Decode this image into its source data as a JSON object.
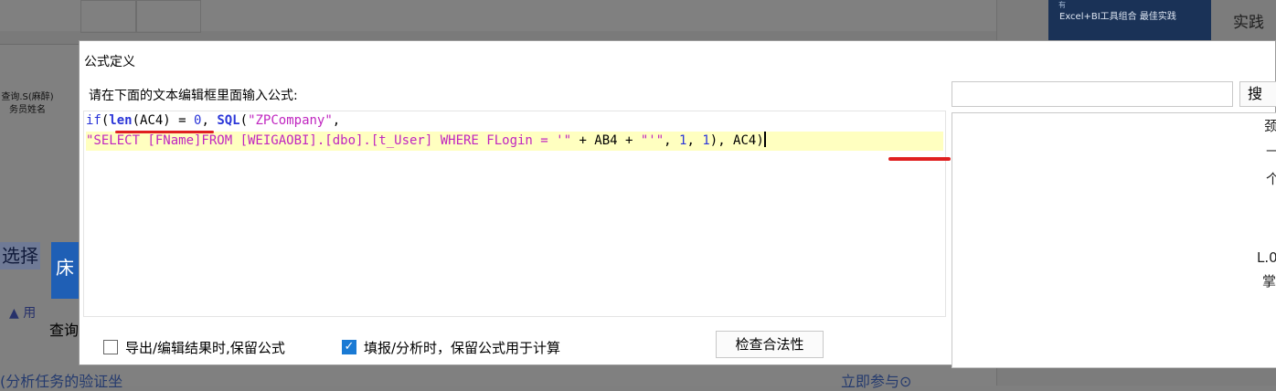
{
  "background": {
    "left_label": "查询.S(麻醉)务员姓名",
    "select_text": "选择",
    "bed_text": "床",
    "user_text": "用",
    "query_text": "查询",
    "bottom_left": "(分析任务的验证坐",
    "bottom_right": "立即参与⊙",
    "ad_small": "有",
    "ad_text": "Excel+BI工具组合 最佳实践",
    "shijian": "实践",
    "side_frags": [
      "颈",
      "—",
      "个",
      "L.0",
      "掌"
    ]
  },
  "dialog": {
    "title": "公式定义",
    "prompt": "请在下面的文本编辑框里面输入公式:",
    "search_button_label": "搜",
    "formula": {
      "line1": {
        "if": "if",
        "p1": "(",
        "len": "len",
        "p2": "(AC4) = ",
        "zero": "0",
        "p3": ", ",
        "sql": "SQL",
        "p4": "(",
        "arg1": "\"ZPCompany\"",
        "p5": ","
      },
      "line2": {
        "query": "\"SELECT [FName]FROM [WEIGAOBI].[dbo].[t_User] WHERE FLogin = '\"",
        "plus1": " + AB4 + ",
        "quote": "\"'\"",
        "comma1": ", ",
        "one1": "1",
        "comma2": ", ",
        "one2": "1",
        "tail": "), AC4)"
      }
    },
    "options": {
      "keep_on_export_label": "导出/编辑结果时,保留公式",
      "keep_on_export_checked": false,
      "keep_on_fill_label": "填报/分析时，保留公式用于计算",
      "keep_on_fill_checked": true
    },
    "check_button_label": "检查合法性"
  }
}
